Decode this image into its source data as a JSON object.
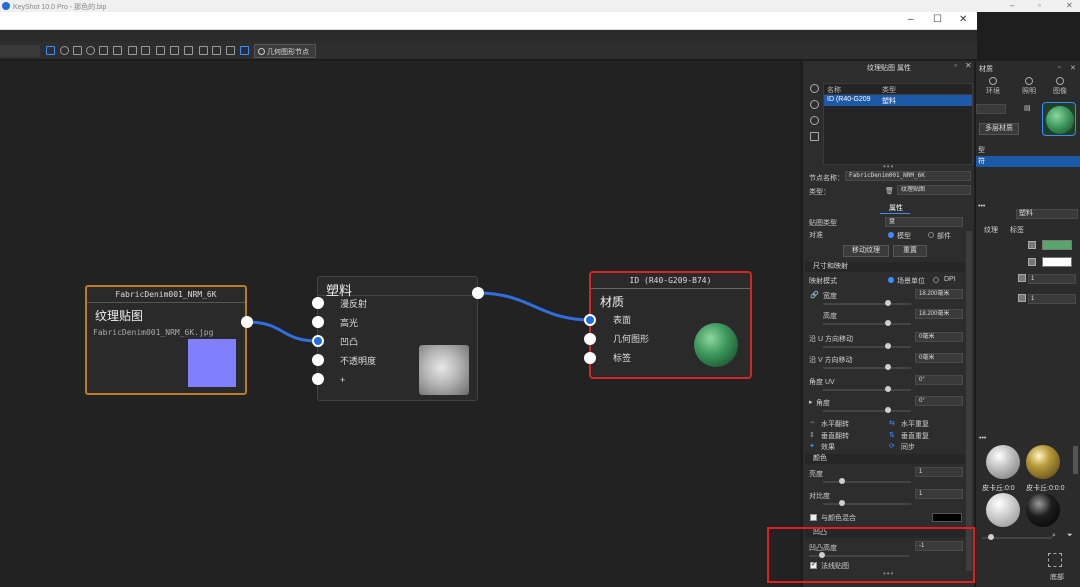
{
  "app": {
    "title": "KeyShot 10.0 Pro - 那色的.bip"
  },
  "toolbar": {
    "geometry_button": "几何图形节点"
  },
  "nodes": {
    "texture": {
      "header": "FabricDenim001_NRM_6K",
      "title": "纹理贴图",
      "filename": "FabricDenim001_NRM_6K.jpg",
      "color": "#8080ff"
    },
    "plastic": {
      "title": "塑料",
      "ports": [
        "漫反射",
        "高光",
        "凹凸",
        "不透明度",
        "+"
      ]
    },
    "material": {
      "header": "ID (R40-G209-B74)",
      "title": "材质",
      "ports": [
        "表面",
        "几何图形",
        "标签"
      ]
    }
  },
  "props": {
    "title": "纹理贴图 属性",
    "table": {
      "col_name": "名称",
      "col_type": "类型",
      "row_name": "ID (R40-G209",
      "row_type": "塑料"
    },
    "node_name_label": "节点名称：",
    "node_name_value": "FabricDenim001_NRM_6K",
    "type_label": "类型：",
    "type_value": "纹理贴图",
    "tab_attr": "属性",
    "map_type_label": "贴图类型",
    "map_type_value": "盘",
    "align_label": "对准",
    "align_model": "模型",
    "align_part": "部件",
    "move_texture_btn": "移动纹理",
    "reset_btn": "重置",
    "section_size": "尺寸和映射",
    "map_mode_label": "映射模式",
    "map_mode_scene": "场景单位",
    "map_mode_dpi": "DPI",
    "width_label": "宽度",
    "width_value": "18.200毫米",
    "height_label": "高度",
    "height_value": "18.200毫米",
    "u_move_label": "沿 U 方向移动",
    "u_move_value": "0毫米",
    "v_move_label": "沿 V 方向移动",
    "v_move_value": "0毫米",
    "uv_angle_label": "角度 UV",
    "uv_angle_value": "0°",
    "angle_label": "角度",
    "angle_value": "0°",
    "h_flip": "水平翻转",
    "h_repeat": "水平重复",
    "v_flip": "垂直翻转",
    "v_repeat": "垂直重复",
    "effect": "效果",
    "sync": "同步",
    "section_color": "颜色",
    "brightness_label": "亮度",
    "brightness_value": "1",
    "contrast_label": "对比度",
    "contrast_value": "1",
    "blend_color_label": "与颜色混合",
    "section_bump": "凹凸",
    "bump_height_label": "凹凸高度",
    "bump_height_value": "-1",
    "normal_map_label": "法线贴图",
    "dots": "•••"
  },
  "rpanel": {
    "title": "材质",
    "tab_env": "环境",
    "tab_light": "照明",
    "tab_image": "图像",
    "multi_btn": "多层材质",
    "type_label": "型",
    "selected": "符",
    "dropdown": "塑料",
    "tab_texture": "纹理",
    "tab_label": "标签",
    "field1": "1",
    "field2": "1",
    "ball1_name": "皮卡丘:0:0",
    "ball2_name": "皮卡丘:0:0:0",
    "bottom_label": "底部",
    "green": "#5aa56a",
    "white": "#ffffff"
  }
}
